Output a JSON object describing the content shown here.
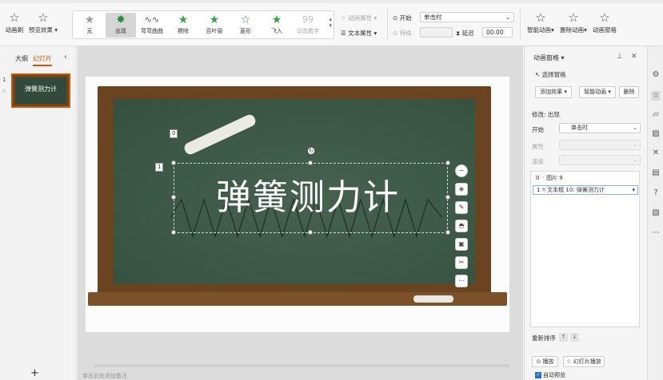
{
  "ribbon": {
    "animation_pane_label": "动画刷",
    "preview_label": "预览效果",
    "effects": [
      {
        "label": "无",
        "icon": "star-outline-icon",
        "selected": false,
        "dim": false
      },
      {
        "label": "出现",
        "icon": "star-burst-icon",
        "selected": true,
        "dim": false
      },
      {
        "label": "弯弯曲曲",
        "icon": "wave-icon",
        "selected": false,
        "dim": false
      },
      {
        "label": "擦除",
        "icon": "star-green-icon",
        "selected": false,
        "dim": false
      },
      {
        "label": "百叶窗",
        "icon": "star-blinds-icon",
        "selected": false,
        "dim": false
      },
      {
        "label": "菱形",
        "icon": "star-diamond-icon",
        "selected": false,
        "dim": false
      },
      {
        "label": "飞入",
        "icon": "star-fly-icon",
        "selected": false,
        "dim": false
      },
      {
        "label": "动态数字",
        "icon": "digits-icon",
        "selected": false,
        "dim": true
      }
    ],
    "anim_attr_label": "动画属性",
    "text_attr_label": "文本属性",
    "start_label": "开始",
    "start_value": "单击时",
    "duration_label": "持续",
    "delay_label": "延迟",
    "delay_value": "00.00",
    "smart_anim_label": "智能动画",
    "delete_anim_label": "删除动画",
    "anim_pane_btn_label": "动画窗格"
  },
  "left_panel": {
    "tab_outline": "大纲",
    "tab_slides": "幻灯片",
    "slide_number": "1",
    "thumb_text": "弹簧测力计",
    "add_label": "+"
  },
  "slide": {
    "title": "弹簧测力计",
    "marker_0": "0",
    "marker_1": "1",
    "notes_placeholder": "单击此处添加备注"
  },
  "anim_pane": {
    "title": "动画窗格",
    "select_pane": "选择窗格",
    "add_effect": "添加效果",
    "smart_anim": "智能动画",
    "delete": "删除",
    "modify_label": "修改: 出现",
    "start_label": "开始",
    "start_value": "单击时",
    "property_label": "属性",
    "speed_label": "速度",
    "items": [
      {
        "index": "0",
        "text": "图片 9",
        "selected": false
      },
      {
        "index": "1",
        "text": "文本框 10: 弹簧测力计",
        "selected": true
      }
    ],
    "reorder_label": "重新排序",
    "play_label": "播放",
    "slideshow_label": "幻灯片播放",
    "auto_preview_label": "自动预览",
    "auto_preview_checked": true
  },
  "colors": {
    "accent": "#c8590a",
    "board": "#3f5a4a",
    "frame": "#6a4420"
  }
}
